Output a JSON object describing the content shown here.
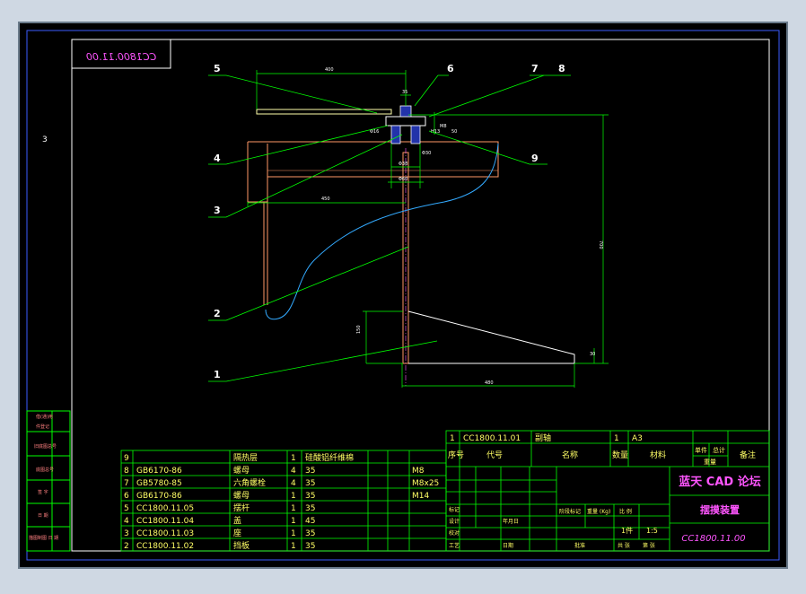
{
  "drawing_code_mirrored": "CC1800.11.00",
  "side_mark": "3",
  "balloons": [
    "5",
    "6",
    "7",
    "8",
    "4",
    "3",
    "2",
    "1",
    "9"
  ],
  "dimensions": {
    "arm_length": "400",
    "top_d1": "35",
    "top_d2": "Φ16",
    "dim_small_a": "H13",
    "dim_small_b": "M8",
    "dim_small_c": "50",
    "dim_small_d": "Φ30",
    "dim_small_e": "Φ38",
    "hub_d": "Φ60",
    "span_450": "450",
    "height_total": "700",
    "base_height": "150",
    "base_step": "30",
    "base_length": "480"
  },
  "left_strip": [
    "借(通)用",
    "件登记",
    "旧底图总号",
    "底图总号",
    "签 字",
    "日 期",
    "描图制图 日 期"
  ],
  "bom": {
    "rows": [
      {
        "seq": "9",
        "code": "",
        "name": "隔热层",
        "qty": "1",
        "mat": "硅酸铝纤维棉",
        "note": ""
      },
      {
        "seq": "8",
        "code": "GB6170-86",
        "name": "螺母",
        "qty": "4",
        "mat": "35",
        "note": "M8"
      },
      {
        "seq": "7",
        "code": "GB5780-85",
        "name": "六角螺栓",
        "qty": "4",
        "mat": "35",
        "note": "M8x25"
      },
      {
        "seq": "6",
        "code": "GB6170-86",
        "name": "螺母",
        "qty": "1",
        "mat": "35",
        "note": "M14"
      },
      {
        "seq": "5",
        "code": "CC1800.11.05",
        "name": "摆杆",
        "qty": "1",
        "mat": "35",
        "note": ""
      },
      {
        "seq": "4",
        "code": "CC1800.11.04",
        "name": "盖",
        "qty": "1",
        "mat": "45",
        "note": ""
      },
      {
        "seq": "3",
        "code": "CC1800.11.03",
        "name": "座",
        "qty": "1",
        "mat": "35",
        "note": ""
      },
      {
        "seq": "2",
        "code": "CC1800.11.02",
        "name": "挡板",
        "qty": "1",
        "mat": "35",
        "note": ""
      }
    ],
    "header_row": {
      "seq": "1",
      "code": "CC1800.11.01",
      "name": "副轴",
      "qty": "1",
      "mat": "A3",
      "note": ""
    },
    "header_labels": [
      "序号",
      "代号",
      "名称",
      "数量",
      "材料",
      "单件",
      "总计",
      "重量",
      "备注"
    ]
  },
  "title_block": {
    "forum": "蓝天 CAD 论坛",
    "assembly_name": "摆摸装置",
    "drawing_code": "CC1800.11.00",
    "mass_label": "重量 (Kg)",
    "scale_label": "比 例",
    "stage_label": "阶段标记",
    "sheet_label": "共 1 张",
    "scale_value": "1:5",
    "sheets": "1件",
    "row_labels": [
      "设计",
      "标记",
      "处数",
      "分区",
      "更改文件号",
      "签名",
      "年月日",
      "校对",
      "审核",
      "工艺",
      "日期",
      "批准",
      "共 张",
      "第 张"
    ]
  }
}
